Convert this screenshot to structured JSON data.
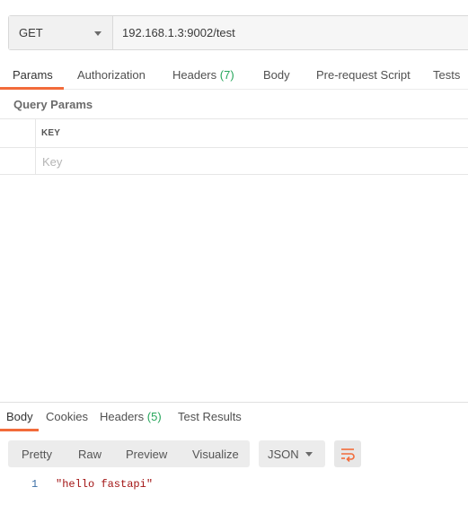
{
  "request": {
    "method": "GET",
    "url": "192.168.1.3:9002/test"
  },
  "request_tabs": {
    "params": "Params",
    "authorization": "Authorization",
    "headers": "Headers",
    "headers_count": "(7)",
    "body": "Body",
    "pre_request_script": "Pre-request Script",
    "tests": "Tests"
  },
  "query_params": {
    "title": "Query Params",
    "key_header": "KEY",
    "key_placeholder": "Key"
  },
  "response_tabs": {
    "body": "Body",
    "cookies": "Cookies",
    "headers": "Headers",
    "headers_count": "(5)",
    "test_results": "Test Results"
  },
  "response_view": {
    "pretty": "Pretty",
    "raw": "Raw",
    "preview": "Preview",
    "visualize": "Visualize",
    "format": "JSON",
    "wrap_icon": "wrap-lines-icon"
  },
  "response_body": {
    "lines": [
      {
        "number": "1",
        "text": "\"hello fastapi\""
      }
    ]
  },
  "colors": {
    "accent": "#f26b3a",
    "count": "#26a65b",
    "string": "#a31515"
  }
}
